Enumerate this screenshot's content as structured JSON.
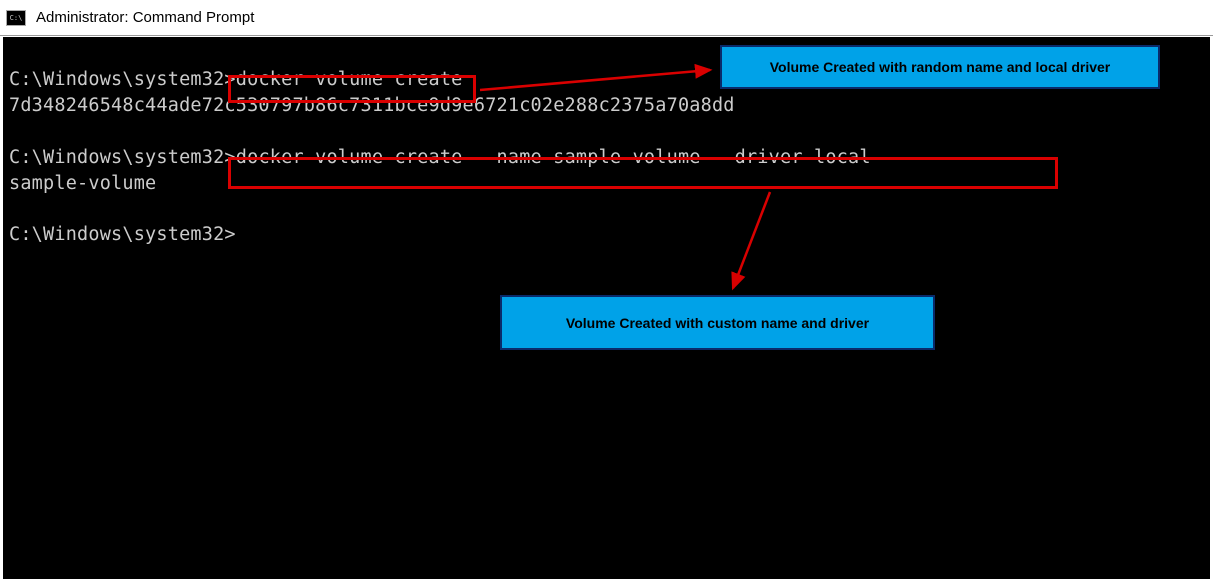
{
  "window": {
    "title": "Administrator: Command Prompt"
  },
  "terminal": {
    "line1_prompt": "C:\\Windows\\system32>",
    "line1_cmd": "docker volume create",
    "line2_output": "7d348246548c44ade72c530797b86c7311bce9d9e6721c02e288c2375a70a8dd",
    "line3_prompt": "C:\\Windows\\system32>",
    "line3_cmd": "docker volume create --name sample-volume --driver local",
    "line4_output": "sample-volume",
    "line5_prompt": "C:\\Windows\\system32>"
  },
  "annotations": {
    "box1": "Volume Created with random name and local driver",
    "box2": "Volume Created with custom name and driver"
  }
}
